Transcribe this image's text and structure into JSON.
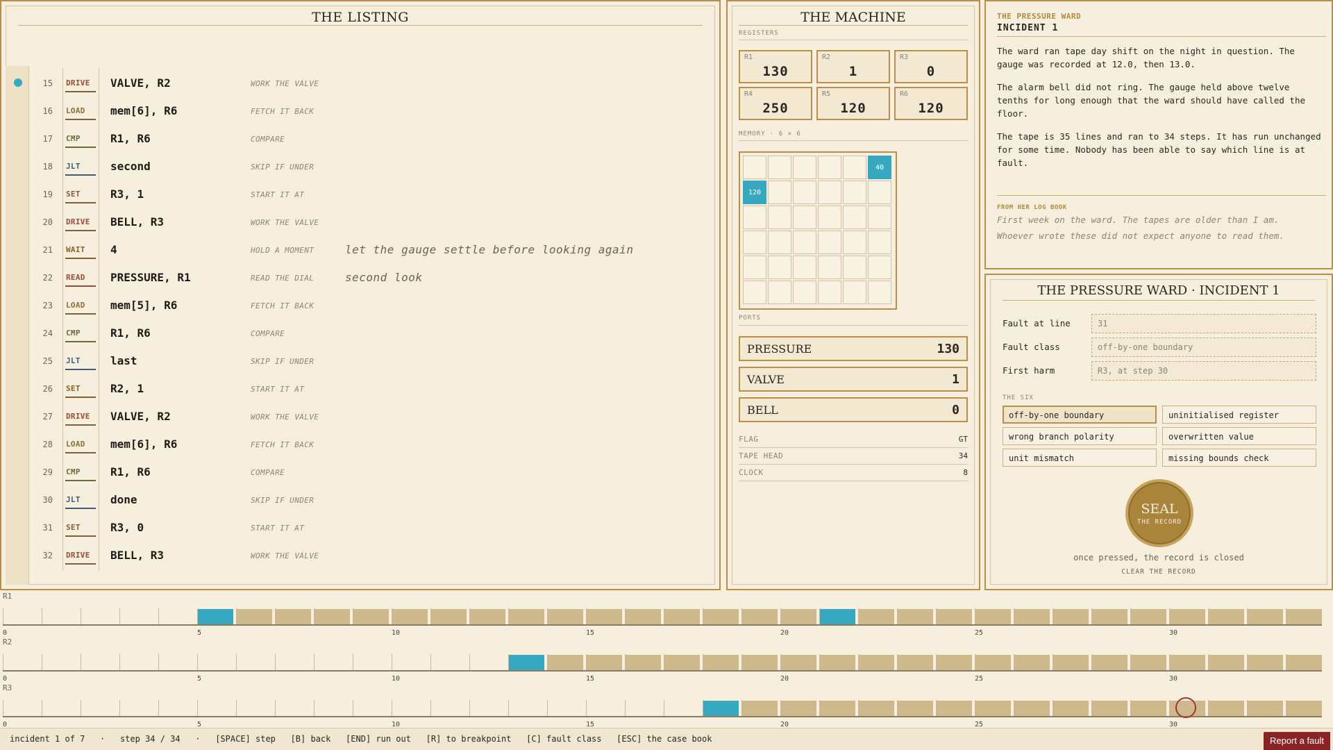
{
  "listing": {
    "title": "THE LISTING",
    "rows": [
      {
        "num": "15",
        "op": "DRIVE",
        "args": "VALVE, R2",
        "comment": "WORK THE VALVE",
        "note": ""
      },
      {
        "num": "16",
        "op": "LOAD",
        "args": "mem[6], R6",
        "comment": "FETCH IT BACK",
        "note": ""
      },
      {
        "num": "17",
        "op": "CMP",
        "args": "R1, R6",
        "comment": "COMPARE",
        "note": ""
      },
      {
        "num": "18",
        "op": "JLT",
        "args": "second",
        "comment": "SKIP IF UNDER",
        "note": ""
      },
      {
        "num": "19",
        "op": "SET",
        "args": "R3, 1",
        "comment": "START IT AT",
        "note": ""
      },
      {
        "num": "20",
        "op": "DRIVE",
        "args": "BELL, R3",
        "comment": "WORK THE VALVE",
        "note": ""
      },
      {
        "num": "21",
        "op": "WAIT",
        "args": "4",
        "comment": "HOLD A MOMENT",
        "note": "let the gauge settle before looking again"
      },
      {
        "num": "22",
        "op": "READ",
        "args": "PRESSURE, R1",
        "comment": "READ THE DIAL",
        "note": "second look"
      },
      {
        "num": "23",
        "op": "LOAD",
        "args": "mem[5], R6",
        "comment": "FETCH IT BACK",
        "note": ""
      },
      {
        "num": "24",
        "op": "CMP",
        "args": "R1, R6",
        "comment": "COMPARE",
        "note": ""
      },
      {
        "num": "25",
        "op": "JLT",
        "args": "last",
        "comment": "SKIP IF UNDER",
        "note": ""
      },
      {
        "num": "26",
        "op": "SET",
        "args": "R2, 1",
        "comment": "START IT AT",
        "note": ""
      },
      {
        "num": "27",
        "op": "DRIVE",
        "args": "VALVE, R2",
        "comment": "WORK THE VALVE",
        "note": ""
      },
      {
        "num": "28",
        "op": "LOAD",
        "args": "mem[6], R6",
        "comment": "FETCH IT BACK",
        "note": ""
      },
      {
        "num": "29",
        "op": "CMP",
        "args": "R1, R6",
        "comment": "COMPARE",
        "note": ""
      },
      {
        "num": "30",
        "op": "JLT",
        "args": "done",
        "comment": "SKIP IF UNDER",
        "note": ""
      },
      {
        "num": "31",
        "op": "SET",
        "args": "R3, 0",
        "comment": "START IT AT",
        "note": ""
      },
      {
        "num": "32",
        "op": "DRIVE",
        "args": "BELL, R3",
        "comment": "WORK THE VALVE",
        "note": ""
      }
    ],
    "op_colors": {
      "DRIVE": "#9a4a35",
      "LOAD": "#8a6f3a",
      "CMP": "#6a6a3a",
      "JLT": "#3d5e7a",
      "SET": "#8a5f2e",
      "WAIT": "#8a5f2e",
      "READ": "#9a4a35"
    },
    "underline_colors": {
      "DRIVE": "#7a5f3a",
      "LOAD": "#7a5f3a",
      "CMP": "#6a6a3a",
      "JLT": "#3d5e7a",
      "SET": "#8a5f2e",
      "WAIT": "#8a5f2e",
      "READ": "#9a4a35"
    }
  },
  "machine": {
    "title": "THE MACHINE",
    "registers_label": "REGISTERS",
    "registers": [
      {
        "name": "R1",
        "value": "130"
      },
      {
        "name": "R2",
        "value": "1"
      },
      {
        "name": "R3",
        "value": "0"
      },
      {
        "name": "R4",
        "value": "250"
      },
      {
        "name": "R5",
        "value": "120"
      },
      {
        "name": "R6",
        "value": "120"
      }
    ],
    "memory_label": "MEMORY · 6 × 6",
    "memory_cells": [
      {
        "row": 0,
        "col": 5,
        "value": "40"
      },
      {
        "row": 1,
        "col": 0,
        "value": "120"
      }
    ],
    "ports_label": "PORTS",
    "ports": [
      {
        "name": "PRESSURE",
        "value": "130"
      },
      {
        "name": "VALVE",
        "value": "1"
      },
      {
        "name": "BELL",
        "value": "0"
      }
    ],
    "status": [
      {
        "name": "FLAG",
        "value": "GT"
      },
      {
        "name": "TAPE HEAD",
        "value": "34"
      },
      {
        "name": "CLOCK",
        "value": "8"
      }
    ]
  },
  "case": {
    "kicker": "THE PRESSURE WARD",
    "heading": "INCIDENT 1",
    "paragraphs": [
      "The ward ran tape day shift on the night in question. The gauge was recorded at 12.0, then 13.0.",
      "The alarm bell did not ring. The gauge held above twelve tenths for long enough that the ward should have called the floor.",
      "The tape is 35 lines and ran to 34 steps. It has run unchanged for some time. Nobody has been able to say which line is at fault."
    ],
    "log_kicker": "FROM HER LOG BOOK",
    "log_lines": [
      "First week on the ward. The tapes are older than I am.",
      "Whoever wrote these did not expect anyone to read them."
    ]
  },
  "form": {
    "title": "THE PRESSURE WARD · INCIDENT 1",
    "fields": [
      {
        "label": "Fault at line",
        "value": "31"
      },
      {
        "label": "Fault class",
        "value": "off-by-one boundary"
      },
      {
        "label": "First harm",
        "value": "R3, at step 30"
      }
    ],
    "six_label": "THE SIX",
    "six": [
      {
        "label": "off-by-one boundary",
        "selected": true
      },
      {
        "label": "uninitialised register",
        "selected": false
      },
      {
        "label": "wrong branch polarity",
        "selected": false
      },
      {
        "label": "overwritten value",
        "selected": false
      },
      {
        "label": "unit mismatch",
        "selected": false
      },
      {
        "label": "missing bounds check",
        "selected": false
      }
    ],
    "seal_title": "SEAL",
    "seal_sub": "THE RECORD",
    "seal_hint": "once pressed, the record is closed",
    "clear_label": "CLEAR THE RECORD"
  },
  "timeline": {
    "steps": 34,
    "tick_labels": [
      "0",
      "5",
      "10",
      "15",
      "20",
      "25",
      "30"
    ],
    "tracks": [
      {
        "name": "R1",
        "first_bar": 5,
        "highlight": [
          5,
          21
        ]
      },
      {
        "name": "R2",
        "first_bar": 13,
        "highlight": [
          13
        ]
      },
      {
        "name": "R3",
        "first_bar": 18,
        "highlight": [
          18
        ],
        "breakpoint": 30
      }
    ],
    "colors": {
      "bar": "#cdb98b",
      "highlight": "#36a9c1",
      "breakpoint": "#a33535"
    }
  },
  "statusbar": {
    "text": "incident 1 of 7   ·   step 34 / 34   ·   [SPACE] step   [B] back   [END] run out   [R] to breakpoint   [C] fault class   [ESC] the case book"
  },
  "report_label": "Report a fault"
}
